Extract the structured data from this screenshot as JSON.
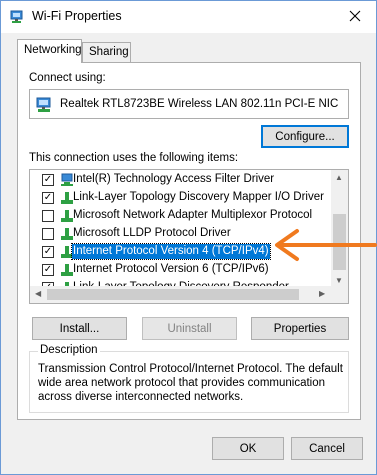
{
  "window": {
    "title": "Wi-Fi Properties"
  },
  "tabs": [
    {
      "label": "Networking",
      "active": true
    },
    {
      "label": "Sharing",
      "active": false
    }
  ],
  "connect_using": {
    "label": "Connect using:",
    "adapter": "Realtek RTL8723BE Wireless LAN 802.11n PCI-E NIC",
    "configure_button": "Configure..."
  },
  "items_label": "This connection uses the following items:",
  "items": [
    {
      "label": "Intel(R) Technology Access Filter Driver",
      "checked": true,
      "icon": "service-icon"
    },
    {
      "label": "Link-Layer Topology Discovery Mapper I/O Driver",
      "checked": true,
      "icon": "protocol-icon"
    },
    {
      "label": "Microsoft Network Adapter Multiplexor Protocol",
      "checked": false,
      "icon": "protocol-icon"
    },
    {
      "label": "Microsoft LLDP Protocol Driver",
      "checked": false,
      "icon": "protocol-icon"
    },
    {
      "label": "Internet Protocol Version 4 (TCP/IPv4)",
      "checked": true,
      "icon": "protocol-icon",
      "selected": true
    },
    {
      "label": "Internet Protocol Version 6 (TCP/IPv6)",
      "checked": true,
      "icon": "protocol-icon"
    },
    {
      "label": "Link-Layer Topology Discovery Responder",
      "checked": true,
      "icon": "protocol-icon"
    }
  ],
  "buttons": {
    "install": "Install...",
    "uninstall": "Uninstall",
    "properties": "Properties",
    "ok": "OK",
    "cancel": "Cancel"
  },
  "description": {
    "title": "Description",
    "text": "Transmission Control Protocol/Internet Protocol. The default wide area network protocol that provides communication across diverse interconnected networks."
  },
  "colors": {
    "selection": "#0078d7",
    "annotation_arrow": "#f07a1f"
  }
}
